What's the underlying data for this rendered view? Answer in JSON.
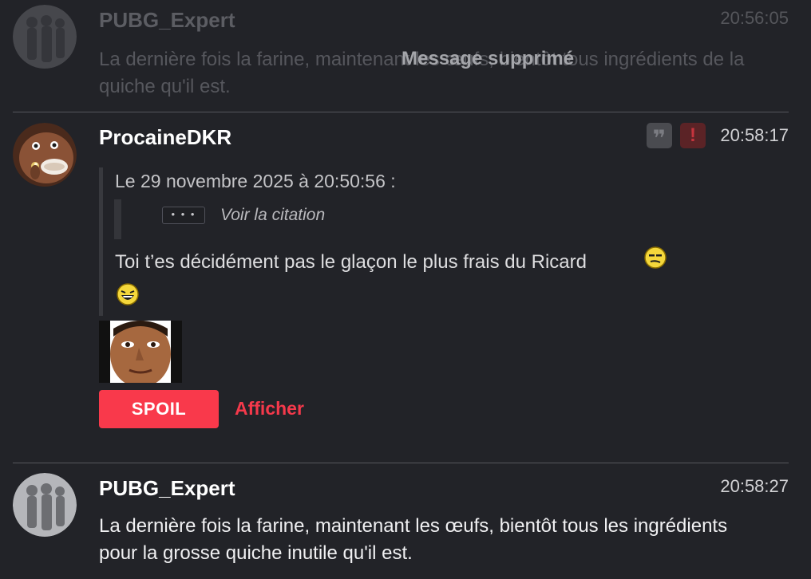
{
  "posts": [
    {
      "author": "PUBG_Expert",
      "time": "20:56:05",
      "text": "La dernière fois la farine, maintenant les œufs, bientôt tous ingrédients de la quiche qu'il est.",
      "overlay": "Message supprimé"
    },
    {
      "author": "ProcaineDKR",
      "time": "20:58:17",
      "quote_header": "Le 29 novembre 2025 à 20:50:56 :",
      "see_quote": "Voir la citation",
      "ellipsis": "• • •",
      "text": "Toi t’es décidément pas le glaçon le plus frais du Ricard",
      "spoil_label": "SPOIL",
      "show_label": "Afficher",
      "action_quote_glyph": "❞",
      "action_report_glyph": "!"
    },
    {
      "author": "PUBG_Expert",
      "time": "20:58:27",
      "text": "La dernière fois la farine, maintenant les œufs, bientôt tous les ingrédients pour la grosse quiche inutile qu'il est."
    }
  ],
  "colors": {
    "background": "#222328",
    "accent": "#f9394b",
    "report": "#c6343e"
  },
  "icons": [
    "default-avatar-icon",
    "quote-icon",
    "report-icon",
    "smirk-smiley-icon",
    "laughing-smiley-icon"
  ]
}
